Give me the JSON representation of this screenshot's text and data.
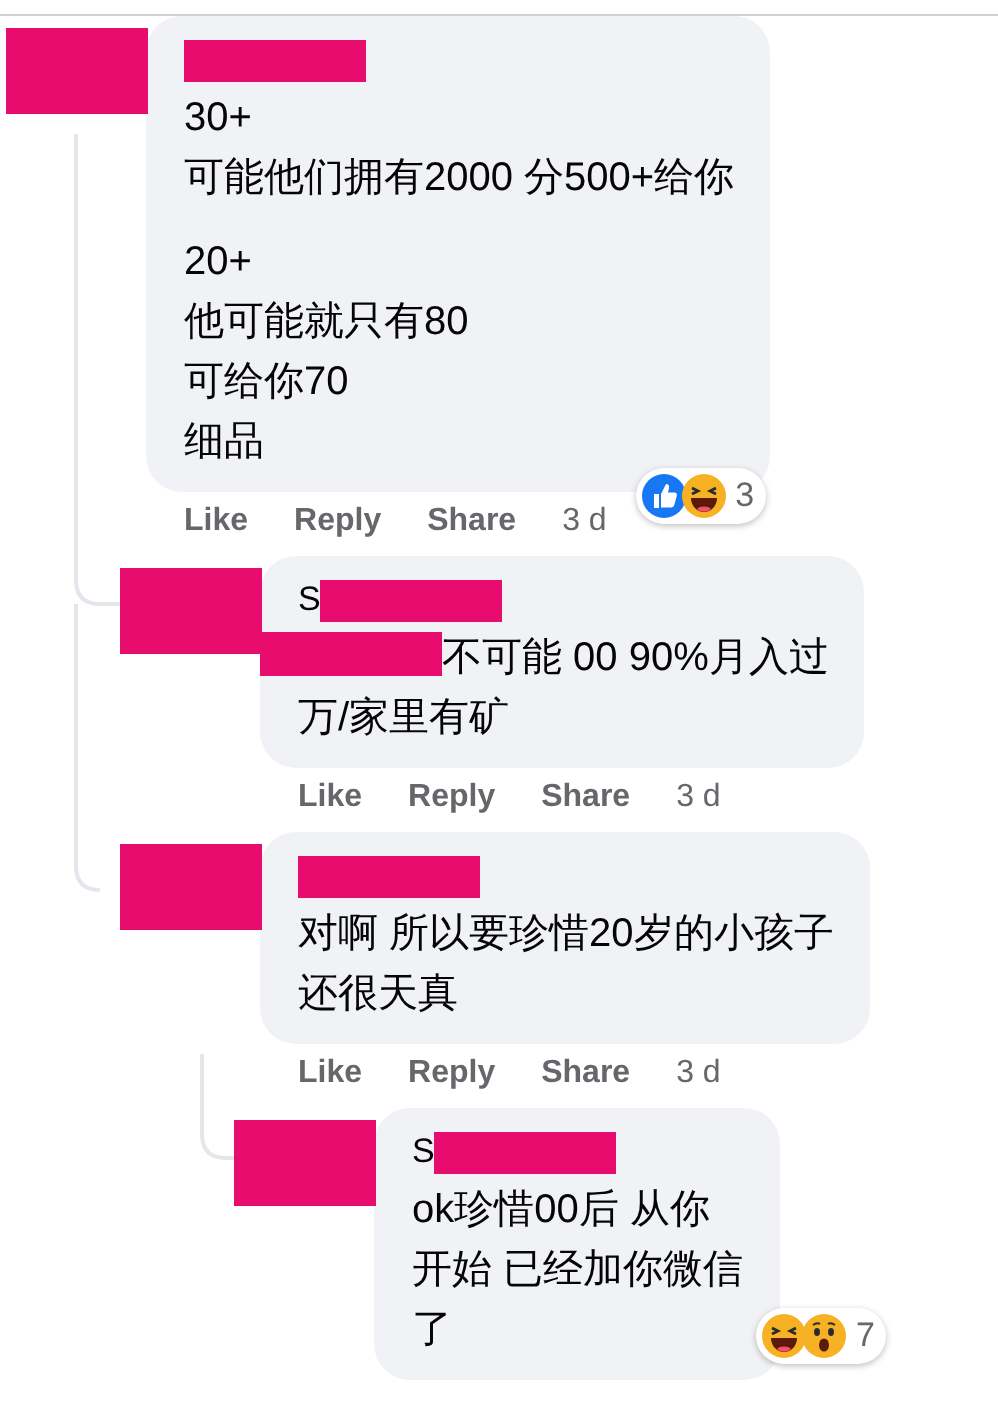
{
  "comments": [
    {
      "paragraphs": [
        [
          "30+",
          "可能他们拥有2000 分500+给你"
        ],
        [
          "20+",
          "他可能就只有80",
          "可给你70",
          "细品"
        ]
      ],
      "actions": [
        "Like",
        "Reply",
        "Share"
      ],
      "time": "3 d",
      "reactions": {
        "icons": [
          {
            "kind": "like"
          },
          {
            "kind": "haha"
          }
        ],
        "count": "3"
      },
      "replies": [
        {
          "author": {
            "initial": "S"
          },
          "body_prefix_redacted": true,
          "paragraphs": [
            [
              "不可能 00 90%月入过",
              "万/家里有矿"
            ]
          ],
          "actions": [
            "Like",
            "Reply",
            "Share"
          ],
          "time": "3 d"
        },
        {
          "paragraphs": [
            [
              "对啊 所以要珍惜20岁的小孩子",
              "还很天真"
            ]
          ],
          "actions": [
            "Like",
            "Reply",
            "Share"
          ],
          "time": "3 d",
          "replies": [
            {
              "author": {
                "initial": "S"
              },
              "paragraphs": [
                [
                  "ok珍惜00后 从你",
                  "开始 已经加你微信",
                  "了"
                ]
              ],
              "reactions": {
                "icons": [
                  {
                    "kind": "haha"
                  },
                  {
                    "kind": "wow"
                  }
                ],
                "count": "7"
              }
            }
          ]
        }
      ]
    }
  ]
}
